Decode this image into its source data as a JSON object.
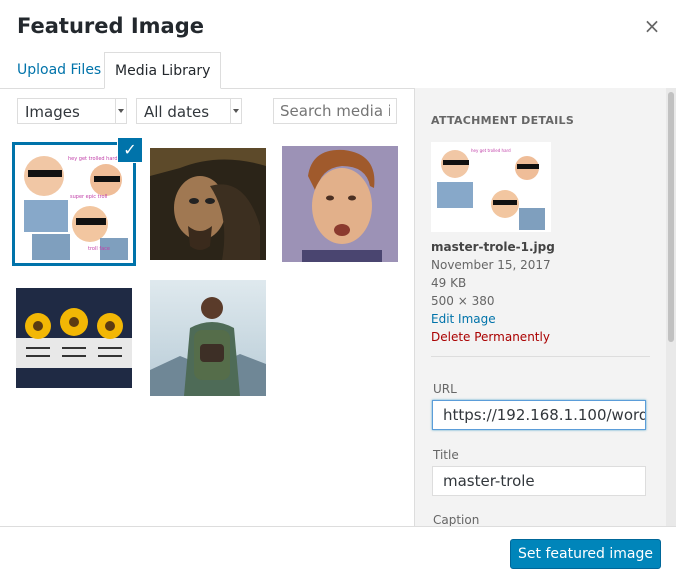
{
  "modal": {
    "title": "Featured Image",
    "close_icon": "×"
  },
  "tabs": [
    {
      "label": "Upload Files"
    },
    {
      "label": "Media Library"
    }
  ],
  "filters": {
    "type": "Images",
    "date": "All dates",
    "search_placeholder": "Search media items..."
  },
  "grid": {
    "items": [
      {
        "name": "master-trole-1",
        "selected": true
      },
      {
        "name": "pirate",
        "selected": false
      },
      {
        "name": "rick",
        "selected": false
      },
      {
        "name": "sunflowers",
        "selected": false
      },
      {
        "name": "hiker",
        "selected": false
      }
    ],
    "check_icon": "✓"
  },
  "sidebar": {
    "heading": "ATTACHMENT DETAILS",
    "filename": "master-trole-1.jpg",
    "date": "November 15, 2017",
    "size": "49 KB",
    "dimensions": "500 × 380",
    "edit_link": "Edit Image",
    "delete_link": "Delete Permanently",
    "url_label": "URL",
    "url_value": "https://192.168.1.100/word",
    "title_label": "Title",
    "title_value": "master-trole",
    "caption_label": "Caption"
  },
  "footer": {
    "button": "Set featured image"
  },
  "colors": {
    "accent": "#0073aa",
    "primary_button": "#0085ba",
    "danger": "#a00"
  }
}
